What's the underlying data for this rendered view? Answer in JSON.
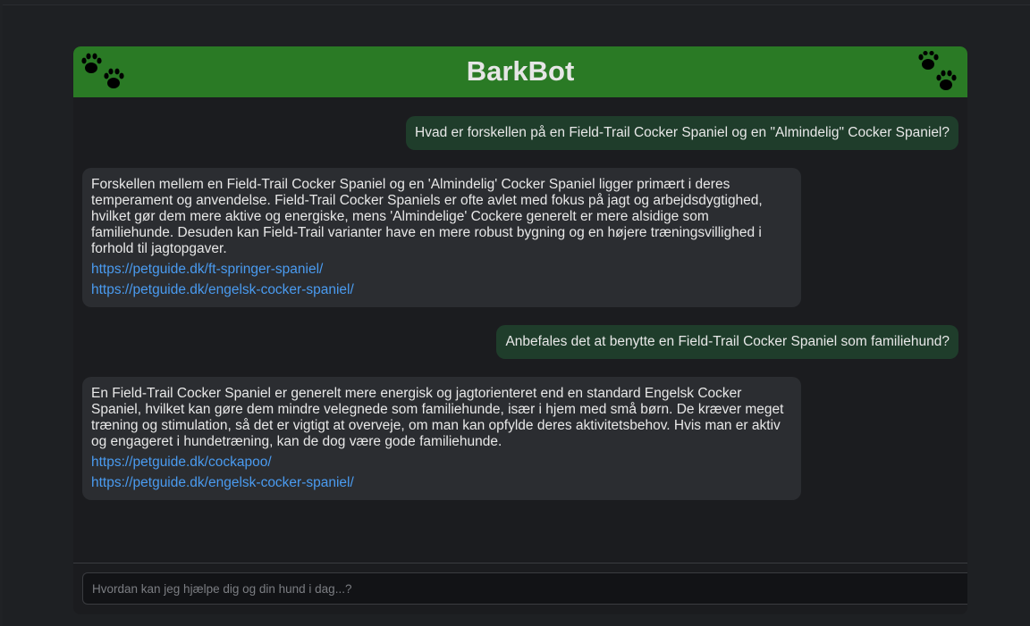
{
  "app": {
    "title": "BarkBot"
  },
  "colors": {
    "header": "#2a7a25",
    "user_bubble": "#1f3d2b",
    "bot_bubble": "#2b2d31",
    "link": "#4a9bf0",
    "background": "#1b1c1f"
  },
  "icons": {
    "header_left": "paw-prints-icon",
    "header_right": "paw-prints-icon"
  },
  "messages": [
    {
      "role": "user",
      "text": "Hvad er forskellen på en Field-Trail Cocker Spaniel og en \"Almindelig\" Cocker Spaniel?"
    },
    {
      "role": "bot",
      "text": "Forskellen mellem en Field-Trail Cocker Spaniel og en 'Almindelig' Cocker Spaniel ligger primært i deres temperament og anvendelse. Field-Trail Cocker Spaniels er ofte avlet med fokus på jagt og arbejdsdygtighed, hvilket gør dem mere aktive og energiske, mens 'Almindelige' Cockere generelt er mere alsidige som familiehunde. Desuden kan Field-Trail varianter have en mere robust bygning og en højere træningsvillighed i forhold til jagtopgaver.",
      "links": [
        "https://petguide.dk/ft-springer-spaniel/",
        "https://petguide.dk/engelsk-cocker-spaniel/"
      ]
    },
    {
      "role": "user",
      "text": "Anbefales det at benytte en Field-Trail Cocker Spaniel som familiehund?"
    },
    {
      "role": "bot",
      "text": "En Field-Trail Cocker Spaniel er generelt mere energisk og jagtorienteret end en standard Engelsk Cocker Spaniel, hvilket kan gøre dem mindre velegnede som familiehunde, især i hjem med små børn. De kræver meget træning og stimulation, så det er vigtigt at overveje, om man kan opfylde deres aktivitetsbehov. Hvis man er aktiv og engageret i hundetræning, kan de dog være gode familiehunde.",
      "links": [
        "https://petguide.dk/cockapoo/",
        "https://petguide.dk/engelsk-cocker-spaniel/"
      ]
    }
  ],
  "input": {
    "placeholder": "Hvordan kan jeg hjælpe dig og din hund i dag...?",
    "value": ""
  }
}
